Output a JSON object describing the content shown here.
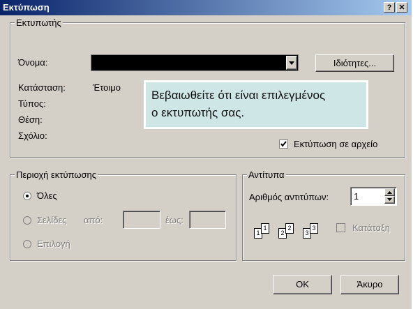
{
  "window": {
    "title": "Εκτύπωση",
    "help_button": "?",
    "close_button": "✕"
  },
  "printer": {
    "group_label": "Εκτυπωτής",
    "name_label": "Όνομα:",
    "name_value": "",
    "properties_button": "Ιδιότητες...",
    "status_label": "Κατάσταση:",
    "status_value": "Έτοιμο",
    "type_label": "Τύπος:",
    "location_label": "Θέση:",
    "comment_label": "Σχόλιο:",
    "print_to_file_label": "Εκτύπωση σε αρχείο",
    "print_to_file_checked": true
  },
  "tooltip": {
    "line1": "Βεβαιωθείτε ότι είναι επιλεγμένος",
    "line2": "ο εκτυπωτής σας."
  },
  "range": {
    "group_label": "Περιοχή εκτύπωσης",
    "all_label": "Όλες",
    "pages_label": "Σελίδες",
    "from_label": "από:",
    "to_label": "έως:",
    "selection_label": "Επιλογή",
    "selected": "all"
  },
  "copies": {
    "group_label": "Αντίτυπα",
    "count_label": "Αριθμός αντιτύπων:",
    "count_value": "1",
    "collate_label": "Κατάταξη",
    "page_labels": [
      "1",
      "1",
      "2",
      "2",
      "3",
      "3"
    ]
  },
  "buttons": {
    "ok": "OK",
    "cancel": "Άκυρο"
  }
}
